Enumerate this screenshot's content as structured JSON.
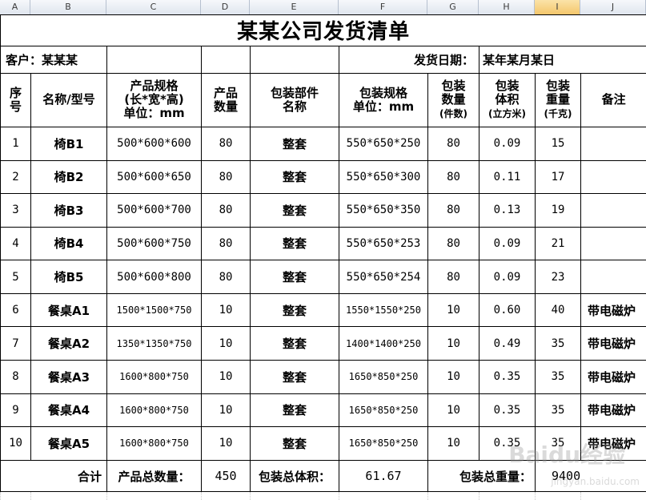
{
  "column_headers": [
    "A",
    "B",
    "C",
    "D",
    "E",
    "F",
    "G",
    "H",
    "I",
    "J"
  ],
  "selected_column": "I",
  "title": "某某公司发货清单",
  "info": {
    "customer_label": "客户：某某某",
    "date_label": "发货日期：",
    "date_value": "某年某月某日"
  },
  "headers": {
    "seq": [
      "序",
      "号"
    ],
    "name": "名称/型号",
    "spec": [
      "产品规格",
      "(长*宽*高)",
      "单位：mm"
    ],
    "qty": [
      "产品",
      "数量"
    ],
    "part": [
      "包装部件",
      "名称"
    ],
    "pack_spec": [
      "包装规格",
      "单位：mm"
    ],
    "pack_qty": [
      "包装",
      "数量",
      "(件数)"
    ],
    "pack_vol": [
      "包装",
      "体积",
      "(立方米)"
    ],
    "pack_wt": [
      "包装",
      "重量",
      "(千克)"
    ],
    "remark": "备注"
  },
  "rows": [
    {
      "seq": "1",
      "name": "椅B1",
      "spec": "500*600*600",
      "qty": "80",
      "part": "整套",
      "pack_spec": "550*650*250",
      "pack_qty": "80",
      "vol": "0.09",
      "weight": "15",
      "remark": ""
    },
    {
      "seq": "2",
      "name": "椅B2",
      "spec": "500*600*650",
      "qty": "80",
      "part": "整套",
      "pack_spec": "550*650*300",
      "pack_qty": "80",
      "vol": "0.11",
      "weight": "17",
      "remark": ""
    },
    {
      "seq": "3",
      "name": "椅B3",
      "spec": "500*600*700",
      "qty": "80",
      "part": "整套",
      "pack_spec": "550*650*350",
      "pack_qty": "80",
      "vol": "0.13",
      "weight": "19",
      "remark": ""
    },
    {
      "seq": "4",
      "name": "椅B4",
      "spec": "500*600*750",
      "qty": "80",
      "part": "整套",
      "pack_spec": "550*650*253",
      "pack_qty": "80",
      "vol": "0.09",
      "weight": "21",
      "remark": ""
    },
    {
      "seq": "5",
      "name": "椅B5",
      "spec": "500*600*800",
      "qty": "80",
      "part": "整套",
      "pack_spec": "550*650*254",
      "pack_qty": "80",
      "vol": "0.09",
      "weight": "23",
      "remark": ""
    },
    {
      "seq": "6",
      "name": "餐桌A1",
      "spec": "1500*1500*750",
      "qty": "10",
      "part": "整套",
      "pack_spec": "1550*1550*250",
      "pack_qty": "10",
      "vol": "0.60",
      "weight": "40",
      "remark": "带电磁炉"
    },
    {
      "seq": "7",
      "name": "餐桌A2",
      "spec": "1350*1350*750",
      "qty": "10",
      "part": "整套",
      "pack_spec": "1400*1400*250",
      "pack_qty": "10",
      "vol": "0.49",
      "weight": "35",
      "remark": "带电磁炉"
    },
    {
      "seq": "8",
      "name": "餐桌A3",
      "spec": "1600*800*750",
      "qty": "10",
      "part": "整套",
      "pack_spec": "1650*850*250",
      "pack_qty": "10",
      "vol": "0.35",
      "weight": "35",
      "remark": "带电磁炉"
    },
    {
      "seq": "9",
      "name": "餐桌A4",
      "spec": "1600*800*750",
      "qty": "10",
      "part": "整套",
      "pack_spec": "1650*850*250",
      "pack_qty": "10",
      "vol": "0.35",
      "weight": "35",
      "remark": "带电磁炉"
    },
    {
      "seq": "10",
      "name": "餐桌A5",
      "spec": "1600*800*750",
      "qty": "10",
      "part": "整套",
      "pack_spec": "1650*850*250",
      "pack_qty": "10",
      "vol": "0.35",
      "weight": "35",
      "remark": "带电磁炉"
    }
  ],
  "totals": {
    "label": "合计",
    "qty_label": "产品总数量：",
    "qty_value": "450",
    "vol_label": "包装总体积：",
    "vol_value": "61.67",
    "wt_label": "包装总重量：",
    "wt_value": "9400"
  },
  "watermark": "Baidu经验",
  "watermark_url": "jingyan.baidu.com"
}
